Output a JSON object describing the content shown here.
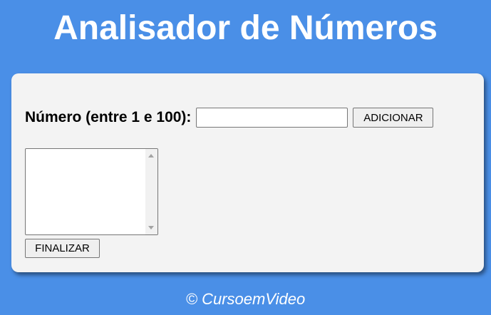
{
  "header": {
    "title": "Analisador de Números"
  },
  "form": {
    "label": "Número (entre 1 e 100):",
    "number_input_value": "",
    "add_button_label": "ADICIONAR",
    "list_items": [],
    "finish_button_label": "FINALIZAR"
  },
  "footer": {
    "text": "© CursoemVideo"
  },
  "colors": {
    "background": "#4a8fe7",
    "card": "#f3f3f3",
    "title_text": "#ffffff"
  }
}
